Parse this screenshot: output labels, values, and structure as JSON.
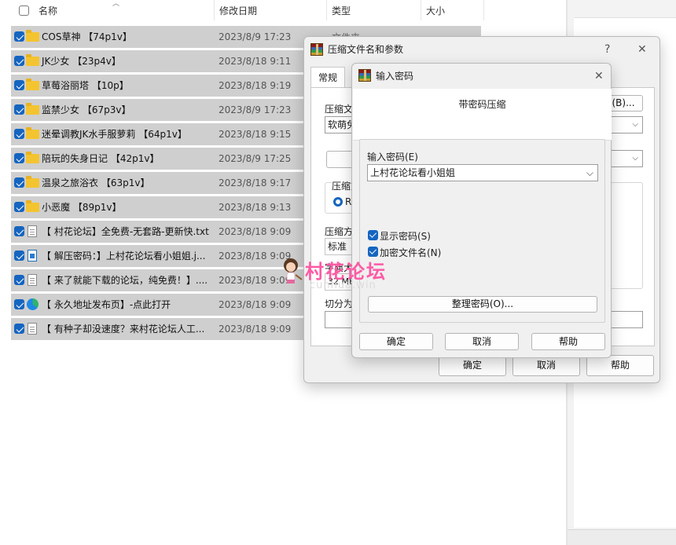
{
  "explorer": {
    "columns": {
      "name": "名称",
      "date": "修改日期",
      "type": "类型",
      "size": "大小"
    },
    "partial_type_text": "文件夹",
    "rows": [
      {
        "name": "COS草神 【74p1v】",
        "date": "2023/8/9 17:23",
        "icon": "folder-icon"
      },
      {
        "name": "JK少女 【23p4v】",
        "date": "2023/8/18 9:11",
        "icon": "folder-icon"
      },
      {
        "name": "草莓浴丽塔 【10p】",
        "date": "2023/8/18 9:19",
        "icon": "folder-icon"
      },
      {
        "name": "监禁少女 【67p3v】",
        "date": "2023/8/9 17:23",
        "icon": "folder-icon"
      },
      {
        "name": "迷晕调教JK水手服萝莉 【64p1v】",
        "date": "2023/8/18 9:15",
        "icon": "folder-icon"
      },
      {
        "name": "陪玩的失身日记 【42p1v】",
        "date": "2023/8/9 17:25",
        "icon": "folder-icon"
      },
      {
        "name": "温泉之旅浴衣 【63p1v】",
        "date": "2023/8/18 9:17",
        "icon": "folder-icon"
      },
      {
        "name": "小恶魔 【89p1v】",
        "date": "2023/8/18 9:13",
        "icon": "folder-icon"
      },
      {
        "name": "【 村花论坛】全免费-无套路-更新快.txt",
        "date": "2023/8/18 9:09",
        "icon": "text-file-icon"
      },
      {
        "name": "【 解压密码：】上村花论坛看小姐姐.j...",
        "date": "2023/8/18 9:09",
        "icon": "image-file-icon"
      },
      {
        "name": "【 来了就能下载的论坛，纯免费！】....",
        "date": "2023/8/18 9:09",
        "icon": "text-file-icon"
      },
      {
        "name": "【 永久地址发布页】-点此打开",
        "date": "2023/8/18 9:09",
        "icon": "edge-browser-icon"
      },
      {
        "name": "【 有种子却没速度？来村花论坛人工...",
        "date": "2023/8/18 9:09",
        "icon": "text-file-icon"
      }
    ]
  },
  "archive_dialog": {
    "title": "压缩文件名和参数",
    "help_glyph": "?",
    "close_glyph": "✕",
    "tab_general": "常规",
    "archive_name_label": "压缩文",
    "archive_name_value": "软萌兔",
    "browse_button": "(B)...",
    "format_label": "压缩文",
    "format_option": "RA",
    "method_label": "压缩方",
    "method_value": "标准",
    "dict_label": "字典大",
    "dict_value": "32 MB",
    "split_label": "切分为",
    "ok_button": "确定",
    "cancel_button": "取消",
    "help_button": "帮助"
  },
  "password_dialog": {
    "title": "输入密码",
    "close_glyph": "✕",
    "header": "带密码压缩",
    "password_label": "输入密码(E)",
    "password_value": "上村花论坛看小姐姐",
    "show_password_label": "显示密码(S)",
    "show_password_checked": true,
    "encrypt_names_label": "加密文件名(N)",
    "encrypt_names_checked": true,
    "organize_button": "整理密码(O)...",
    "ok_button": "确定",
    "cancel_button": "取消",
    "help_button": "帮助"
  },
  "watermark": {
    "title": "村花论坛",
    "subtitle": "cunhua.win"
  },
  "colors": {
    "accent": "#1565c0",
    "selection": "#cfcfcf",
    "watermark": "#ff5aa5"
  }
}
